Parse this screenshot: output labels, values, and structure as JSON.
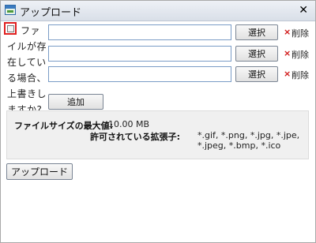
{
  "window": {
    "title": "アップロード",
    "icon": "upload-window-icon",
    "close_glyph": "✕"
  },
  "overwrite": {
    "label": "ファイルが存在している場合、上書きしますか?",
    "checked": false
  },
  "file_rows": [
    {
      "value": "",
      "select_label": "選択",
      "delete_glyph": "×",
      "delete_label": "削除"
    },
    {
      "value": "",
      "select_label": "選択",
      "delete_glyph": "×",
      "delete_label": "削除"
    },
    {
      "value": "",
      "select_label": "選択",
      "delete_glyph": "×",
      "delete_label": "削除"
    }
  ],
  "add_button": {
    "label": "追加"
  },
  "info": {
    "max_size_label": "ファイルサイズの最大値:",
    "max_size_value": "10.00 MB",
    "allowed_ext_label": "許可されている拡張子:",
    "allowed_ext_value": "*.gif, *.png, *.jpg, *.jpe, *.jpeg, *.bmp, *.ico"
  },
  "upload_button": {
    "label": "アップロード"
  },
  "colors": {
    "delete_accent": "#d01515",
    "highlight_border": "#e02020",
    "info_bg": "#f0f0f0"
  }
}
